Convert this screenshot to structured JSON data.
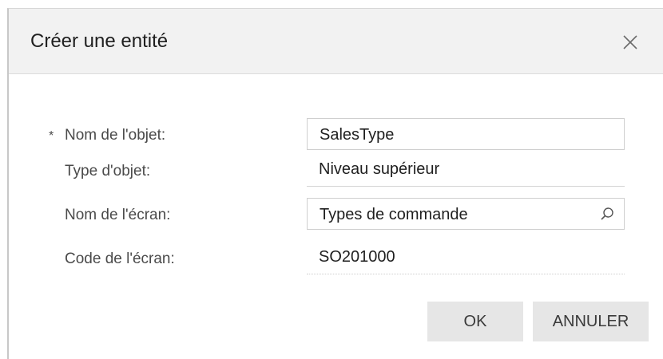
{
  "dialog": {
    "title": "Créer une entité"
  },
  "form": {
    "required_marker": "*",
    "object_name": {
      "label": "Nom de l'objet:",
      "value": "SalesType"
    },
    "object_type": {
      "label": "Type d'objet:",
      "value": "Niveau supérieur"
    },
    "screen_name": {
      "label": "Nom de l'écran:",
      "value": "Types de commande"
    },
    "screen_code": {
      "label": "Code de l'écran:",
      "value": "SO201000"
    }
  },
  "buttons": {
    "ok": "OK",
    "cancel": "ANNULER"
  },
  "icons": {
    "close": "close-icon",
    "search": "search-icon"
  },
  "colors": {
    "header_bg": "#f2f2f2",
    "button_bg": "#e6e6e6",
    "text": "#1f1f1f",
    "label": "#4a4a4a"
  }
}
